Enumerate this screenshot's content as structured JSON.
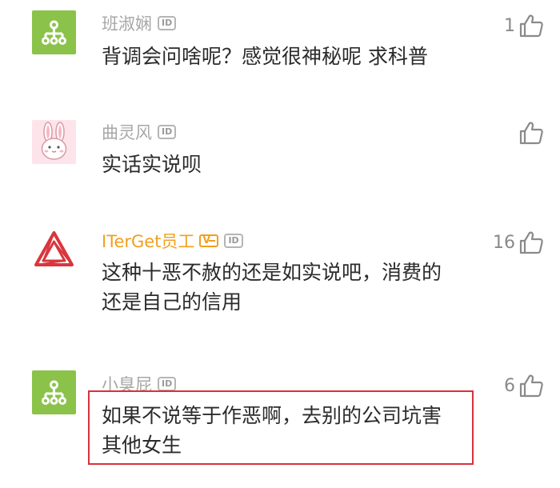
{
  "comments": [
    {
      "username": "班淑娴",
      "id_badge": "ID",
      "avatar_icon": "tree-network-icon",
      "avatar_bg": "#8bc34a",
      "content": "背调会问啥呢？感觉很神秘呢 求科普",
      "likes": "1"
    },
    {
      "username": "曲灵风",
      "id_badge": "ID",
      "avatar_icon": "rabbit-icon",
      "avatar_bg": "#fde4ea",
      "content": "实话实说呗",
      "likes": ""
    },
    {
      "username": "ITerGet员工",
      "id_badge": "ID",
      "avatar_icon": "triangle-logo-icon",
      "avatar_bg": "#ffffff",
      "verified_icon": "verified-v-icon",
      "content": "这种十恶不赦的还是如实说吧，消费的\n还是自己的信用",
      "likes": "16"
    },
    {
      "username": "小臭屁",
      "id_badge": "ID",
      "avatar_icon": "tree-network-icon",
      "avatar_bg": "#8bc34a",
      "content": "如果不说等于作恶啊，去别的公司坑害\n其他女生",
      "likes": "6"
    }
  ],
  "colors": {
    "username": "#a7a7a7",
    "official_username": "#f0a01e",
    "content_text": "#2b2b2b",
    "highlight_border": "#d9303a",
    "like_icon": "#8a8a8a"
  },
  "like_icon": "thumbs-up-icon",
  "verified_badge_text": "V"
}
